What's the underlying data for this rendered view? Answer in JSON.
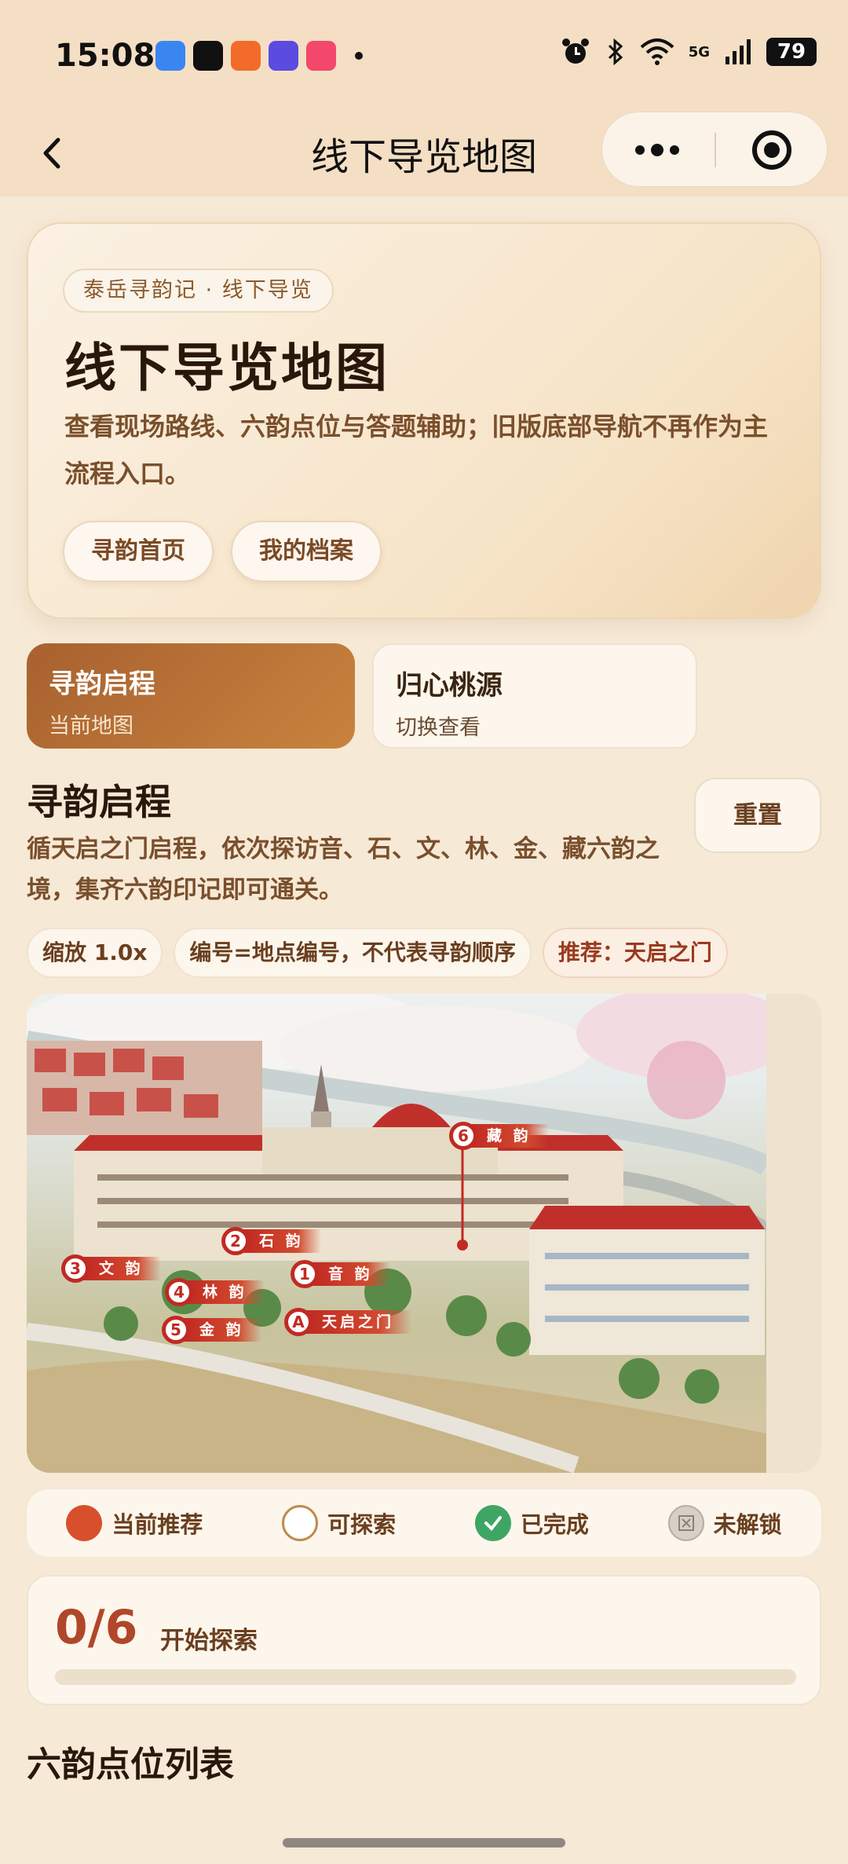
{
  "status_bar": {
    "time": "15:08",
    "battery": "79",
    "network": "5G"
  },
  "navbar": {
    "title": "线下导览地图"
  },
  "hero": {
    "tag": "泰岳寻韵记 · 线下导览",
    "title": "线下导览地图",
    "description": "查看现场路线、六韵点位与答题辅助；旧版底部导航不再作为主流程入口。",
    "buttons": [
      "寻韵首页",
      "我的档案"
    ]
  },
  "routes": [
    {
      "title": "寻韵启程",
      "subtitle": "当前地图",
      "active": true
    },
    {
      "title": "归心桃源",
      "subtitle": "切换查看",
      "active": false
    }
  ],
  "section": {
    "title": "寻韵启程",
    "description": "循天启之门启程，依次探访音、石、文、林、金、藏六韵之境，集齐六韵印记即可通关。",
    "reset_label": "重置"
  },
  "chips": {
    "zoom": "缩放 1.0x",
    "note": "编号=地点编号，不代表寻韵顺序",
    "recommend": "推荐：天启之门"
  },
  "map_markers": [
    {
      "id": "6",
      "label": "藏 韵"
    },
    {
      "id": "2",
      "label": "石 韵"
    },
    {
      "id": "3",
      "label": "文 韵"
    },
    {
      "id": "1",
      "label": "音 韵"
    },
    {
      "id": "4",
      "label": "林 韵"
    },
    {
      "id": "5",
      "label": "金 韵"
    },
    {
      "id": "A",
      "label": "天启之门"
    }
  ],
  "legend": [
    "当前推荐",
    "可探索",
    "已完成",
    "未解锁"
  ],
  "progress": {
    "count": "0/6",
    "label": "开始探索",
    "fraction": 0
  },
  "list_title": "六韵点位列表",
  "colors": {
    "accent": "#c9833e",
    "marker": "#c12a22",
    "done": "#3fa565",
    "current": "#d84f2b"
  }
}
